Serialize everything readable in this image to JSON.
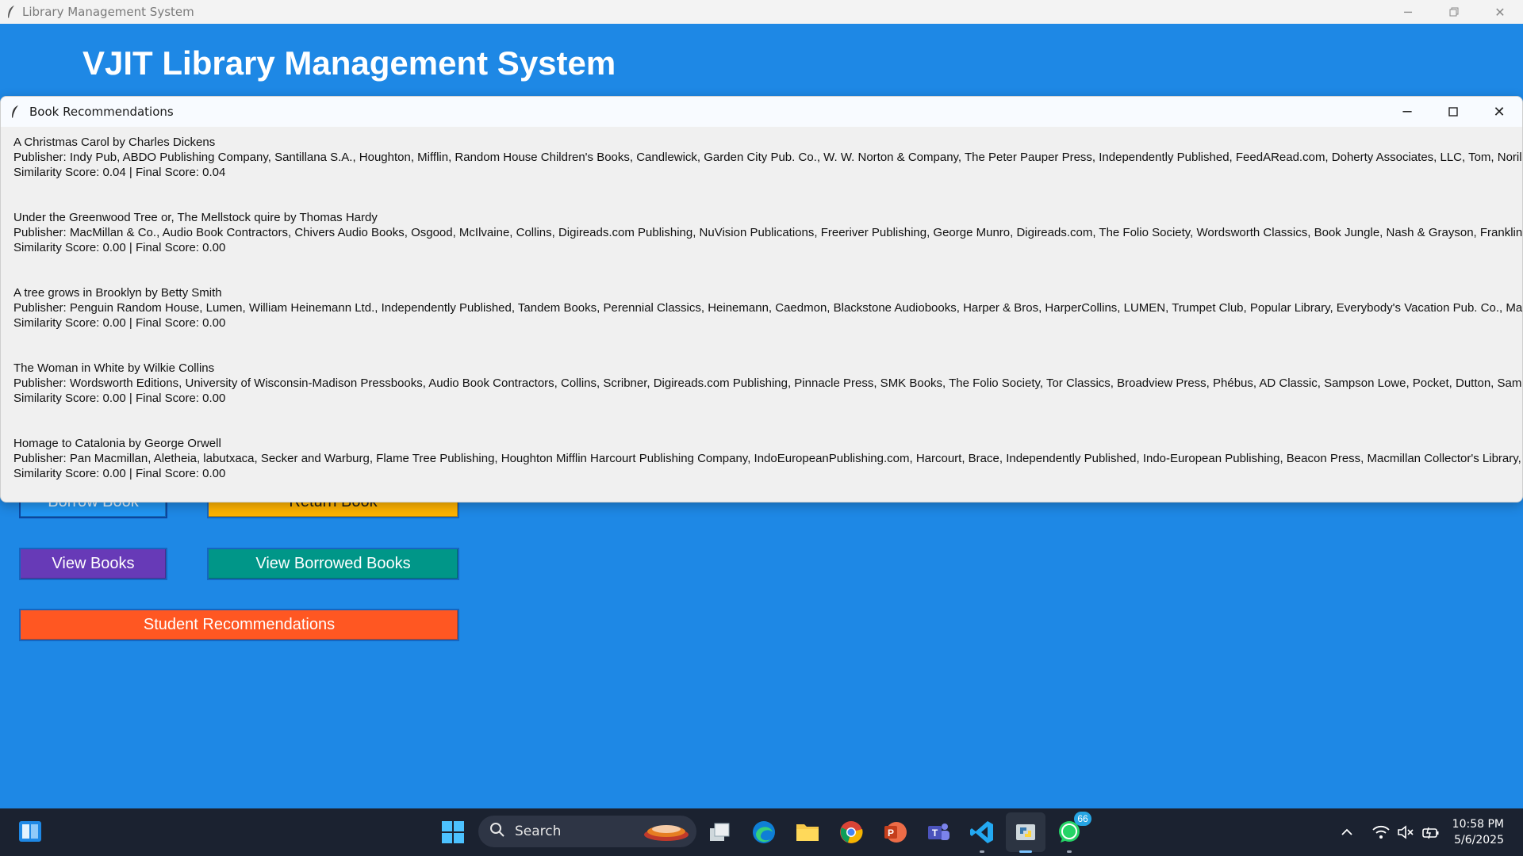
{
  "main_window": {
    "title": "Library Management System",
    "header": "VJIT Library Management System",
    "buttons": {
      "borrow": "Borrow Book",
      "return": "Return Book",
      "view": "View Books",
      "view_borrowed": "View Borrowed Books",
      "recommendations": "Student Recommendations"
    }
  },
  "popup": {
    "title": "Book Recommendations",
    "recommendations": [
      {
        "title_line": "A Christmas Carol by Charles Dickens",
        "publisher_line": "Publisher: Indy Pub, ABDO Publishing Company, Santillana S.A., Houghton, Mifflin, Random House Children's Books, Candlewick, Garden City Pub. Co., W. W. Norton & Company, The Peter Pauper Press, Independently Published, FeedARead.com, Doherty Associates, LLC, Tom, Norilana",
        "score_line": "Similarity Score: 0.04 | Final Score: 0.04"
      },
      {
        "title_line": "Under the Greenwood Tree or, The Mellstock quire by Thomas Hardy",
        "publisher_line": "Publisher: MacMillan & Co., Audio Book Contractors, Chivers Audio Books, Osgood, McIlvaine, Collins, Digireads.com Publishing, NuVision Publications, Freeriver Publishing, George Munro, Digireads.com, The Folio Society, Wordsworth Classics, Book Jungle, Nash & Grayson, Franklin Cla",
        "score_line": "Similarity Score: 0.00 | Final Score: 0.00"
      },
      {
        "title_line": "A tree grows in Brooklyn by Betty Smith",
        "publisher_line": "Publisher: Penguin Random House, Lumen, William Heinemann Ltd., Independently Published, Tandem Books, Perennial Classics, Heinemann, Caedmon, Blackstone Audiobooks, Harper & Bros, HarperCollins, LUMEN, Trumpet Club, Popular Library, Everybody's Vacation Pub. Co., Manda",
        "score_line": "Similarity Score: 0.00 | Final Score: 0.00"
      },
      {
        "title_line": "The Woman in White by Wilkie Collins",
        "publisher_line": "Publisher: Wordsworth Editions, University of Wisconsin-Madison Pressbooks, Audio Book Contractors, Collins, Scribner, Digireads.com Publishing, Pinnacle Press, SMK Books, The Folio Society, Tor Classics, Broadview Press, Phébus, AD Classic, Sampson Lowe, Pocket, Dutton, Sampson Lo",
        "score_line": "Similarity Score: 0.00 | Final Score: 0.00"
      },
      {
        "title_line": "Homage to Catalonia by George Orwell",
        "publisher_line": "Publisher: Pan Macmillan, Aletheia, labutxaca, Secker and Warburg, Flame Tree Publishing, Houghton Mifflin Harcourt Publishing Company, IndoEuropeanPublishing.com, Harcourt, Brace, Independently Published, Indo-European Publishing, Beacon Press, Macmillan Collector's Library, D",
        "score_line": "Similarity Score: 0.00 | Final Score: 0.00"
      }
    ]
  },
  "taskbar": {
    "search_label": "Search",
    "whatsapp_badge": "66",
    "time": "10:58 PM",
    "date": "5/6/2025",
    "icons": [
      "widgets-icon",
      "windows-start-icon",
      "search-icon",
      "task-view-icon",
      "edge-icon",
      "file-explorer-icon",
      "chrome-icon",
      "powerpoint-icon",
      "teams-icon",
      "vscode-icon",
      "python-icon",
      "whatsapp-icon"
    ]
  },
  "colors": {
    "app_background": "#1e88e5",
    "borrow_button": "#2196f3",
    "return_button": "#ffb300",
    "view_button": "#673ab7",
    "view_borrowed_button": "#009688",
    "recommendations_button": "#ff5722",
    "taskbar": "#1b2230"
  }
}
